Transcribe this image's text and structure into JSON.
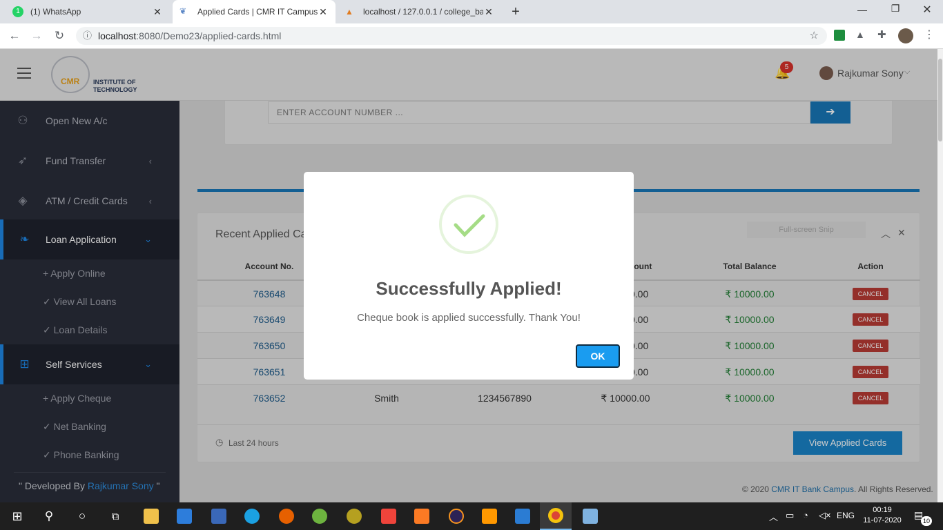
{
  "browser": {
    "tabs": [
      {
        "title": "(1) WhatsApp",
        "badge": "1"
      },
      {
        "title": "Applied Cards | CMR IT Campus"
      },
      {
        "title": "localhost / 127.0.0.1 / college_ba"
      }
    ],
    "url_host": "localhost",
    "url_rest": ":8080/Demo23/applied-cards.html"
  },
  "header": {
    "logo_line1": "INSTITUTE OF",
    "logo_line2": "TECHNOLOGY",
    "logo_cmr": "CMR",
    "notification_count": "5",
    "user_name": "Rajkumar Sony"
  },
  "sidebar": {
    "items": [
      {
        "label": "Open New A/c",
        "icon": "user-icon"
      },
      {
        "label": "Fund Transfer",
        "icon": "rocket-icon"
      },
      {
        "label": "ATM / Credit Cards",
        "icon": "layers-icon"
      },
      {
        "label": "Loan Application",
        "icon": "leaf-icon"
      },
      {
        "label": "Self Services",
        "icon": "gift-icon"
      }
    ],
    "loan_sub": [
      "Apply Online",
      "View All Loans",
      "Loan Details"
    ],
    "self_sub": [
      "Apply Cheque",
      "Net Banking",
      "Phone Banking"
    ],
    "footer_prefix": "\" Developed By ",
    "footer_name": "Rajkumar Sony",
    "footer_suffix": " \""
  },
  "main": {
    "search_placeholder": "ENTER  ACCOUNT  NUMBER ...",
    "recent_title": "Recent Applied Ca",
    "snip_label": "Full-screen Snip",
    "columns": {
      "account": "Account No.",
      "amount": "mount",
      "total": "Total Balance",
      "action": "Action"
    },
    "rows": [
      {
        "account": "763648",
        "amount": "0.00",
        "total": "₹ 10000.00",
        "action": "CANCEL"
      },
      {
        "account": "763649",
        "amount": "0.00",
        "total": "₹ 10000.00",
        "action": "CANCEL"
      },
      {
        "account": "763650",
        "amount": "0.00",
        "total": "₹ 10000.00",
        "action": "CANCEL"
      },
      {
        "account": "763651",
        "amount": "0.00",
        "total": "₹ 10000.00",
        "action": "CANCEL"
      },
      {
        "account": "763652",
        "name": "Smith",
        "phone": "1234567890",
        "amount": "₹ 10000.00",
        "total": "₹ 10000.00",
        "action": "CANCEL"
      }
    ],
    "footer_time": "Last 24 hours",
    "view_button": "View Applied Cards",
    "copyright_prefix": "© 2020 ",
    "copyright_link": "CMR IT Bank Campus",
    "copyright_suffix": ". All Rights Reserved."
  },
  "modal": {
    "title": "Successfully Applied!",
    "message": "Cheque book is applied successfully. Thank You!",
    "ok": "OK"
  },
  "taskbar": {
    "lang": "ENG",
    "time": "00:19",
    "date": "11-07-2020",
    "notif_count": "10"
  },
  "colors": {
    "accent": "#1e88e5",
    "sidebar": "#2a2d3a",
    "cancel": "#b93b35",
    "ok_button": "#1a9cf0",
    "check": "#a5dc86"
  }
}
